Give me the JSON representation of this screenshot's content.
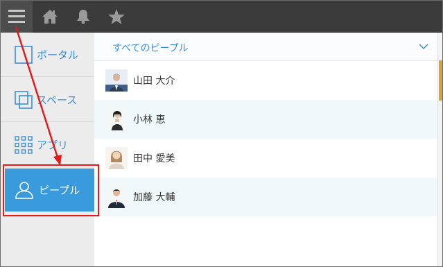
{
  "topbar": {
    "icons": [
      "menu-icon",
      "home-icon",
      "bell-icon",
      "star-icon"
    ],
    "background": "#3b3b3b"
  },
  "sidebar": {
    "items": [
      {
        "label": "ポータル",
        "icon": "portal-icon",
        "selected": false
      },
      {
        "label": "スペース",
        "icon": "space-icon",
        "selected": false
      },
      {
        "label": "アプリ",
        "icon": "apps-grid-icon",
        "selected": false
      },
      {
        "label": "ピープル",
        "icon": "person-icon",
        "selected": true
      }
    ],
    "accent": "#3a9bdc"
  },
  "main": {
    "filter": {
      "label": "すべてのピープル",
      "icon": "chevron-down-icon"
    },
    "people": [
      {
        "name": "山田 大介"
      },
      {
        "name": "小林 恵"
      },
      {
        "name": "田中 愛美"
      },
      {
        "name": "加藤 大輔"
      }
    ]
  },
  "annotation": {
    "color": "#e21b1b"
  }
}
